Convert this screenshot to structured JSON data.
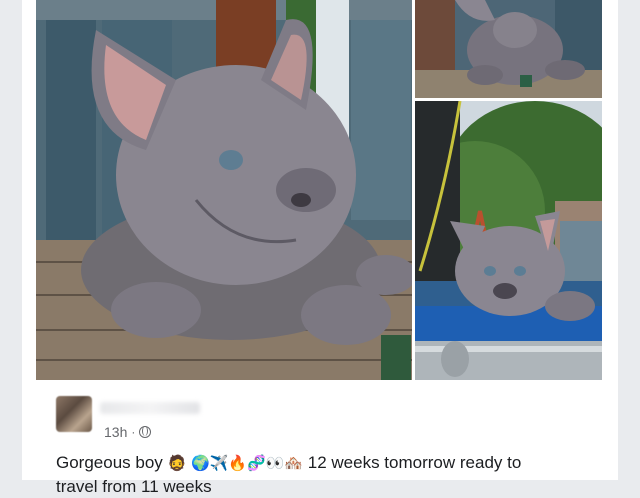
{
  "post": {
    "timestamp": "13h",
    "separator": "·",
    "privacy_icon": "globe-icon",
    "text_start": "Gorgeous boy",
    "emojis": "🧔 🌍✈️🔥🧬👀🏘️",
    "text_end": " 12 weeks tomorrow ready to",
    "text_line2": "travel from 11 weeks"
  },
  "photos": [
    {
      "subject": "blue french bulldog puppy lying on wooden deck"
    },
    {
      "subject": "blue french bulldog puppy sitting on deck"
    },
    {
      "subject": "blue french bulldog puppy on trampoline"
    }
  ],
  "colors": {
    "background": "#e9ebee",
    "card": "#ffffff",
    "text": "#1c1e21",
    "meta": "#65676b"
  }
}
